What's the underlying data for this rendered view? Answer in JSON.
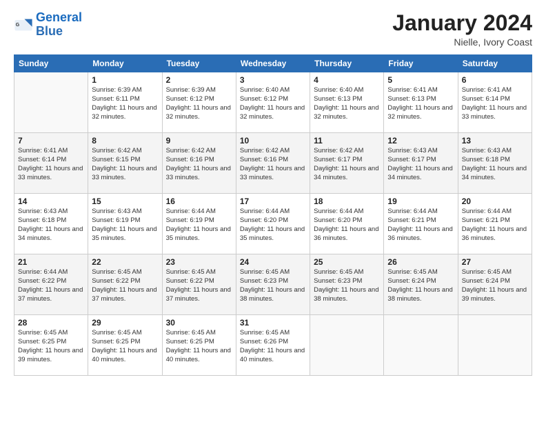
{
  "header": {
    "logo_general": "General",
    "logo_blue": "Blue",
    "month_title": "January 2024",
    "location": "Nielle, Ivory Coast"
  },
  "weekdays": [
    "Sunday",
    "Monday",
    "Tuesday",
    "Wednesday",
    "Thursday",
    "Friday",
    "Saturday"
  ],
  "weeks": [
    [
      {
        "day": "",
        "info": ""
      },
      {
        "day": "1",
        "info": "Sunrise: 6:39 AM\nSunset: 6:11 PM\nDaylight: 11 hours and 32 minutes."
      },
      {
        "day": "2",
        "info": "Sunrise: 6:39 AM\nSunset: 6:12 PM\nDaylight: 11 hours and 32 minutes."
      },
      {
        "day": "3",
        "info": "Sunrise: 6:40 AM\nSunset: 6:12 PM\nDaylight: 11 hours and 32 minutes."
      },
      {
        "day": "4",
        "info": "Sunrise: 6:40 AM\nSunset: 6:13 PM\nDaylight: 11 hours and 32 minutes."
      },
      {
        "day": "5",
        "info": "Sunrise: 6:41 AM\nSunset: 6:13 PM\nDaylight: 11 hours and 32 minutes."
      },
      {
        "day": "6",
        "info": "Sunrise: 6:41 AM\nSunset: 6:14 PM\nDaylight: 11 hours and 33 minutes."
      }
    ],
    [
      {
        "day": "7",
        "info": "Sunrise: 6:41 AM\nSunset: 6:14 PM\nDaylight: 11 hours and 33 minutes."
      },
      {
        "day": "8",
        "info": "Sunrise: 6:42 AM\nSunset: 6:15 PM\nDaylight: 11 hours and 33 minutes."
      },
      {
        "day": "9",
        "info": "Sunrise: 6:42 AM\nSunset: 6:16 PM\nDaylight: 11 hours and 33 minutes."
      },
      {
        "day": "10",
        "info": "Sunrise: 6:42 AM\nSunset: 6:16 PM\nDaylight: 11 hours and 33 minutes."
      },
      {
        "day": "11",
        "info": "Sunrise: 6:42 AM\nSunset: 6:17 PM\nDaylight: 11 hours and 34 minutes."
      },
      {
        "day": "12",
        "info": "Sunrise: 6:43 AM\nSunset: 6:17 PM\nDaylight: 11 hours and 34 minutes."
      },
      {
        "day": "13",
        "info": "Sunrise: 6:43 AM\nSunset: 6:18 PM\nDaylight: 11 hours and 34 minutes."
      }
    ],
    [
      {
        "day": "14",
        "info": "Sunrise: 6:43 AM\nSunset: 6:18 PM\nDaylight: 11 hours and 34 minutes."
      },
      {
        "day": "15",
        "info": "Sunrise: 6:43 AM\nSunset: 6:19 PM\nDaylight: 11 hours and 35 minutes."
      },
      {
        "day": "16",
        "info": "Sunrise: 6:44 AM\nSunset: 6:19 PM\nDaylight: 11 hours and 35 minutes."
      },
      {
        "day": "17",
        "info": "Sunrise: 6:44 AM\nSunset: 6:20 PM\nDaylight: 11 hours and 35 minutes."
      },
      {
        "day": "18",
        "info": "Sunrise: 6:44 AM\nSunset: 6:20 PM\nDaylight: 11 hours and 36 minutes."
      },
      {
        "day": "19",
        "info": "Sunrise: 6:44 AM\nSunset: 6:21 PM\nDaylight: 11 hours and 36 minutes."
      },
      {
        "day": "20",
        "info": "Sunrise: 6:44 AM\nSunset: 6:21 PM\nDaylight: 11 hours and 36 minutes."
      }
    ],
    [
      {
        "day": "21",
        "info": "Sunrise: 6:44 AM\nSunset: 6:22 PM\nDaylight: 11 hours and 37 minutes."
      },
      {
        "day": "22",
        "info": "Sunrise: 6:45 AM\nSunset: 6:22 PM\nDaylight: 11 hours and 37 minutes."
      },
      {
        "day": "23",
        "info": "Sunrise: 6:45 AM\nSunset: 6:22 PM\nDaylight: 11 hours and 37 minutes."
      },
      {
        "day": "24",
        "info": "Sunrise: 6:45 AM\nSunset: 6:23 PM\nDaylight: 11 hours and 38 minutes."
      },
      {
        "day": "25",
        "info": "Sunrise: 6:45 AM\nSunset: 6:23 PM\nDaylight: 11 hours and 38 minutes."
      },
      {
        "day": "26",
        "info": "Sunrise: 6:45 AM\nSunset: 6:24 PM\nDaylight: 11 hours and 38 minutes."
      },
      {
        "day": "27",
        "info": "Sunrise: 6:45 AM\nSunset: 6:24 PM\nDaylight: 11 hours and 39 minutes."
      }
    ],
    [
      {
        "day": "28",
        "info": "Sunrise: 6:45 AM\nSunset: 6:25 PM\nDaylight: 11 hours and 39 minutes."
      },
      {
        "day": "29",
        "info": "Sunrise: 6:45 AM\nSunset: 6:25 PM\nDaylight: 11 hours and 40 minutes."
      },
      {
        "day": "30",
        "info": "Sunrise: 6:45 AM\nSunset: 6:25 PM\nDaylight: 11 hours and 40 minutes."
      },
      {
        "day": "31",
        "info": "Sunrise: 6:45 AM\nSunset: 6:26 PM\nDaylight: 11 hours and 40 minutes."
      },
      {
        "day": "",
        "info": ""
      },
      {
        "day": "",
        "info": ""
      },
      {
        "day": "",
        "info": ""
      }
    ]
  ]
}
